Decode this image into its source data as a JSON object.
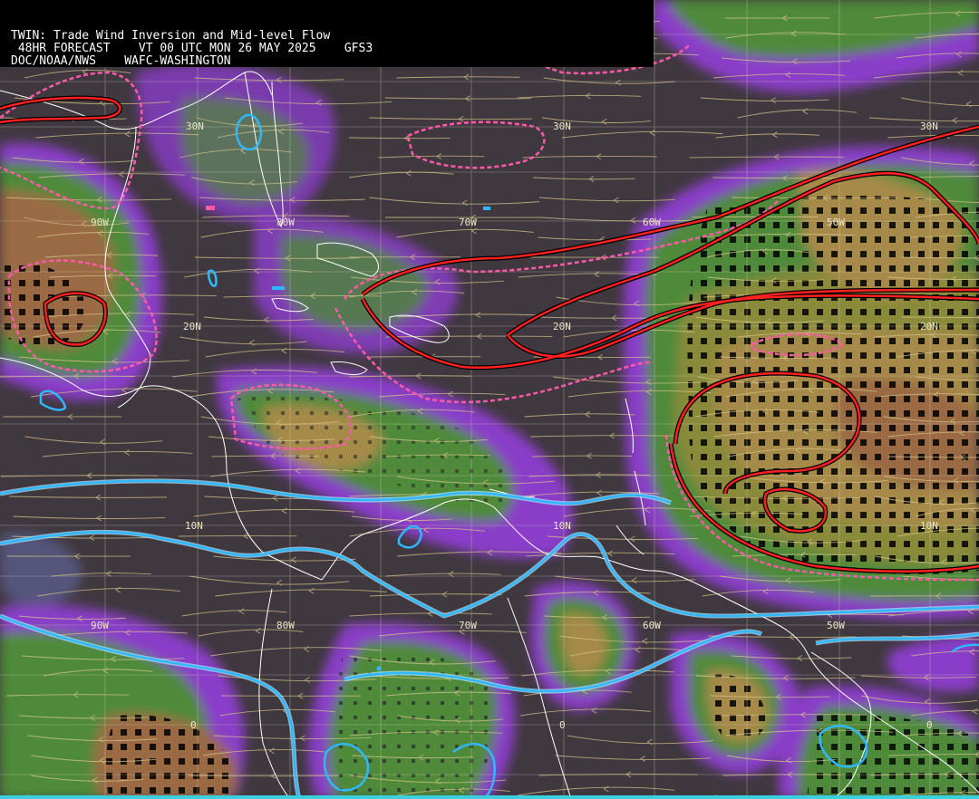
{
  "header": {
    "line1": "TWIN: Trade Wind Inversion and Mid-level Flow",
    "line2": " 48HR FORECAST    VT 00 UTC MON 26 MAY 2025    GFS3",
    "line3": "DOC/NOAA/NWS    WAFC-WASHINGTON"
  },
  "colors": {
    "background": "#40383f",
    "band_purple": "#8a3cc8",
    "band_slate": "#5a5c8c",
    "band_green": "#4f8a3a",
    "band_olive": "#8a8a3a",
    "band_tan": "#a68a4a",
    "band_brown": "#9a6a44",
    "stream": "#d8c78a",
    "grid": "#d8d0b8",
    "coast": "#ffffff",
    "contour_red": "#ff2020",
    "contour_pink": "#ff5aa8",
    "contour_cyan": "#30b8ff",
    "bottom_strip": "#3ad0e0"
  },
  "grid_labels": {
    "lat_30n": [
      "30N",
      "30N",
      "30N"
    ],
    "lat_20n": [
      "20N",
      "20N",
      "20N"
    ],
    "lat_10n": [
      "10N",
      "10N",
      "10N"
    ],
    "lat_0": [
      "0",
      "0",
      "0"
    ],
    "lon_row1": [
      "90W",
      "80W",
      "70W",
      "60W",
      "50W"
    ],
    "lon_row2": [
      "90W",
      "80W",
      "70W",
      "60W",
      "50W"
    ]
  },
  "icons": [
    "streamline-arrows",
    "coastline",
    "grid"
  ]
}
